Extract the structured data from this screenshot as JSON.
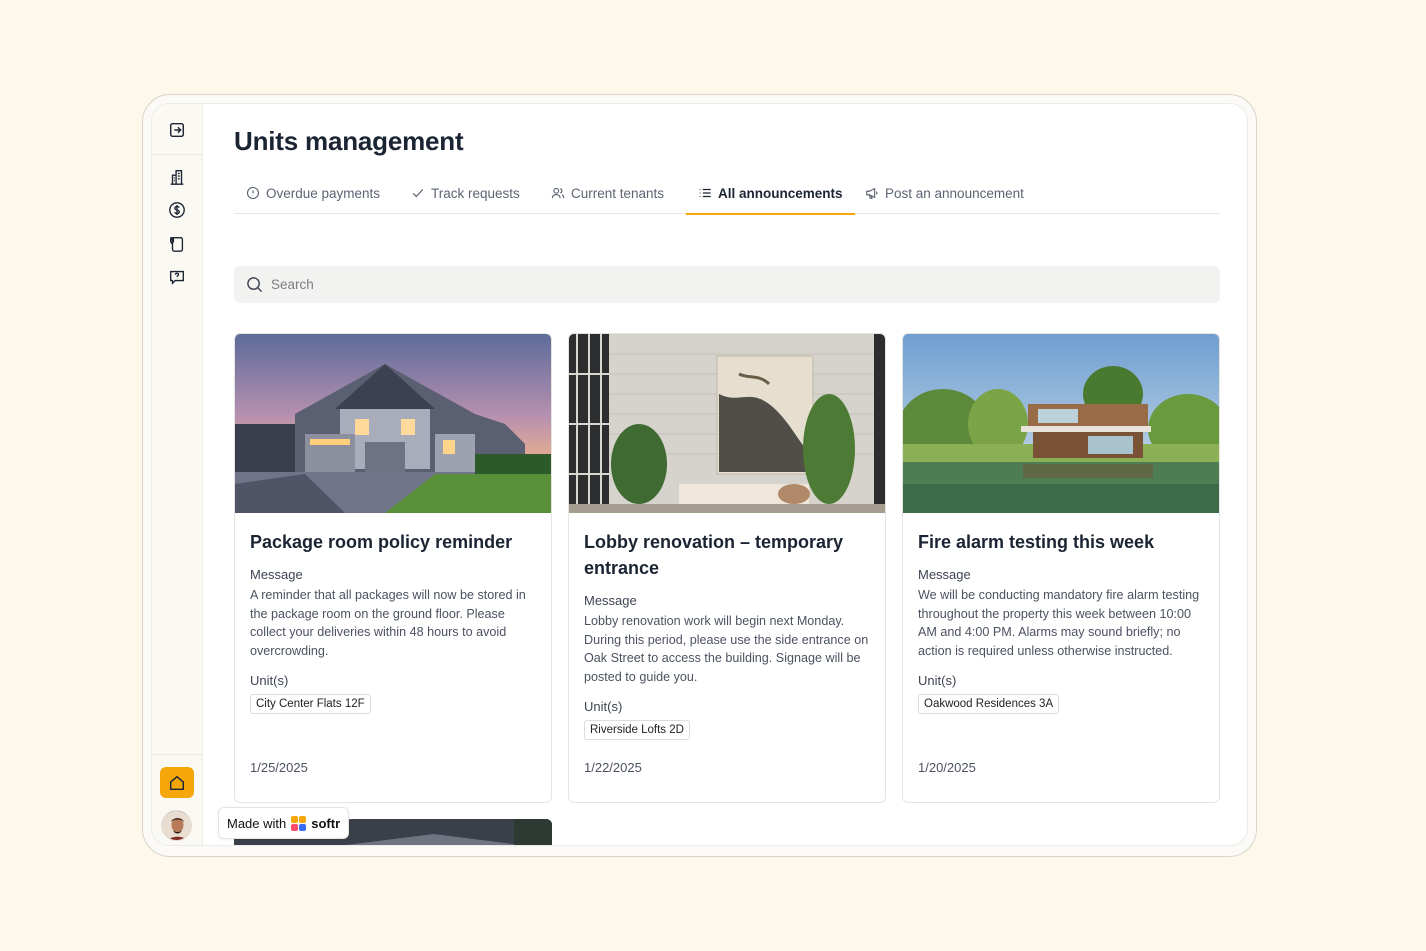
{
  "page": {
    "title": "Units management"
  },
  "sidebar": {
    "icons": [
      "sign-in-icon",
      "building-icon",
      "dollar-circle-icon",
      "clipboard-icon",
      "question-chat-icon"
    ],
    "home_icon": "home-icon",
    "accent": "#f5a70a"
  },
  "tabs": [
    {
      "label": "Overdue payments",
      "icon": "alert-circle-icon"
    },
    {
      "label": "Track requests",
      "icon": "check-icon"
    },
    {
      "label": "Current tenants",
      "icon": "users-icon"
    },
    {
      "label": "All announcements",
      "icon": "list-icon",
      "active": true
    },
    {
      "label": "Post an announcement",
      "icon": "megaphone-icon"
    }
  ],
  "search": {
    "placeholder": "Search"
  },
  "cards": [
    {
      "title": "Package room policy reminder",
      "message_label": "Message",
      "message": "A reminder that all packages will now be stored in the package room on the ground floor. Please collect your deliveries within 48 hours to avoid overcrowding.",
      "units_label": "Unit(s)",
      "unit": "City Center Flats 12F",
      "date": "1/25/2025"
    },
    {
      "title": "Lobby renovation – temporary entrance",
      "message_label": "Message",
      "message": "Lobby renovation work will begin next Monday. During this period, please use the side entrance on Oak Street to access the building. Signage will be posted to guide you.",
      "units_label": "Unit(s)",
      "unit": "Riverside Lofts 2D",
      "date": "1/22/2025"
    },
    {
      "title": "Fire alarm testing this week",
      "message_label": "Message",
      "message": "We will be conducting mandatory fire alarm testing throughout the property this week between 10:00 AM and 4:00 PM. Alarms may sound briefly; no action is required unless otherwise instructed.",
      "units_label": "Unit(s)",
      "unit": "Oakwood Residences 3A",
      "date": "1/20/2025"
    }
  ],
  "badge": {
    "made_with": "Made with",
    "brand": "softr"
  }
}
